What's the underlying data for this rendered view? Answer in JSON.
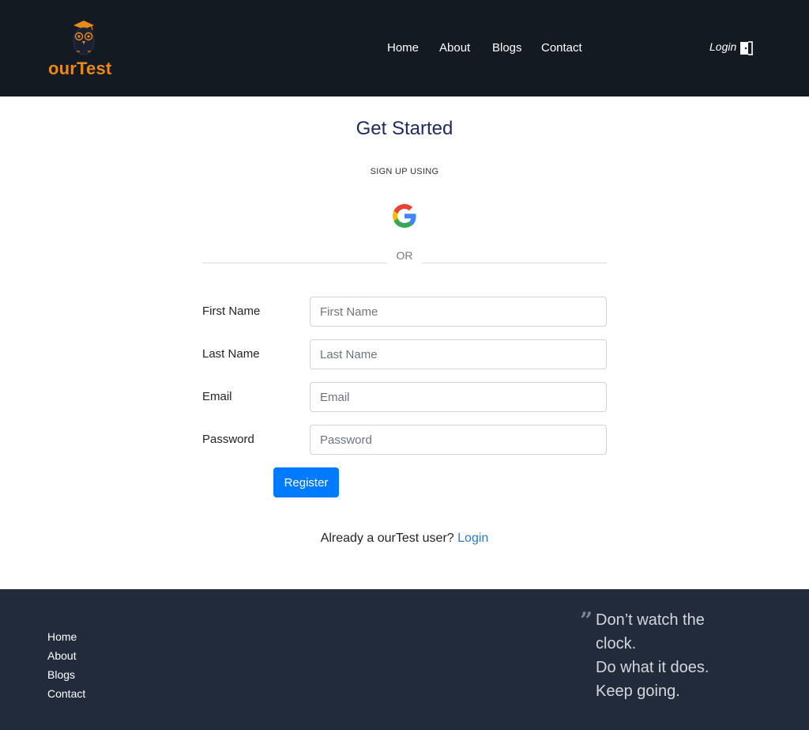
{
  "header": {
    "brand": "ourTest",
    "nav": [
      "Home",
      "About",
      "Blogs",
      "Contact"
    ],
    "login_label": "Login"
  },
  "main": {
    "title": "Get Started",
    "subtitle": "SIGN UP USING",
    "or_text": "OR",
    "fields": [
      {
        "label": "First Name",
        "placeholder": "First Name"
      },
      {
        "label": "Last Name",
        "placeholder": "Last Name"
      },
      {
        "label": "Email",
        "placeholder": "Email"
      },
      {
        "label": "Password",
        "placeholder": "Password"
      }
    ],
    "register_label": "Register",
    "already_text": "Already a ourTest user?",
    "login_link": "Login"
  },
  "footer": {
    "links": [
      "Home",
      "About",
      "Blogs",
      "Contact"
    ],
    "quote_lines": [
      "Don’t watch the",
      "clock.",
      "Do what it does.",
      "Keep going."
    ]
  },
  "colors": {
    "header_bg": "#141a22",
    "footer_bg": "#222b3c",
    "brand_orange": "#e8891a",
    "primary_blue": "#007bff",
    "title_navy": "#1f2a5c"
  }
}
